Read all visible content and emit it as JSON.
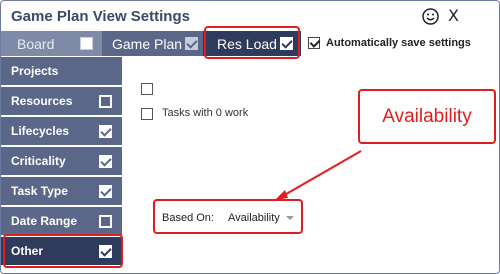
{
  "dialog": {
    "title": "Game Plan View Settings",
    "icons": {
      "smiley": "smiley-icon",
      "close": "close-icon"
    },
    "close_glyph": "X"
  },
  "tabs": [
    {
      "label": "Board",
      "checked": false
    },
    {
      "label": "Game Plan",
      "checked": true
    },
    {
      "label": "Res Load",
      "checked": true,
      "active": true
    }
  ],
  "auto_save": {
    "label": "Automatically save settings",
    "checked": true
  },
  "sidebar": {
    "items": [
      {
        "label": "Projects",
        "checkbox": "none"
      },
      {
        "label": "Resources",
        "checkbox": "unchecked"
      },
      {
        "label": "Lifecycles",
        "checkbox": "checked"
      },
      {
        "label": "Criticality",
        "checkbox": "checked"
      },
      {
        "label": "Task Type",
        "checkbox": "checked"
      },
      {
        "label": "Date Range",
        "checkbox": "unchecked"
      },
      {
        "label": "Other",
        "checkbox": "checked",
        "active": true
      }
    ]
  },
  "options": {
    "first_checkbox_label": "",
    "tasks_zero_work": "Tasks with 0 work"
  },
  "based_on": {
    "label": "Based On:",
    "value": "Availability"
  },
  "annotation": {
    "callout_text": "Availability",
    "color": "#e21d1d"
  },
  "colors": {
    "tab_bg": "#5b6788",
    "active_bg": "#2e3b5d",
    "accent_red": "#e21d1d"
  }
}
